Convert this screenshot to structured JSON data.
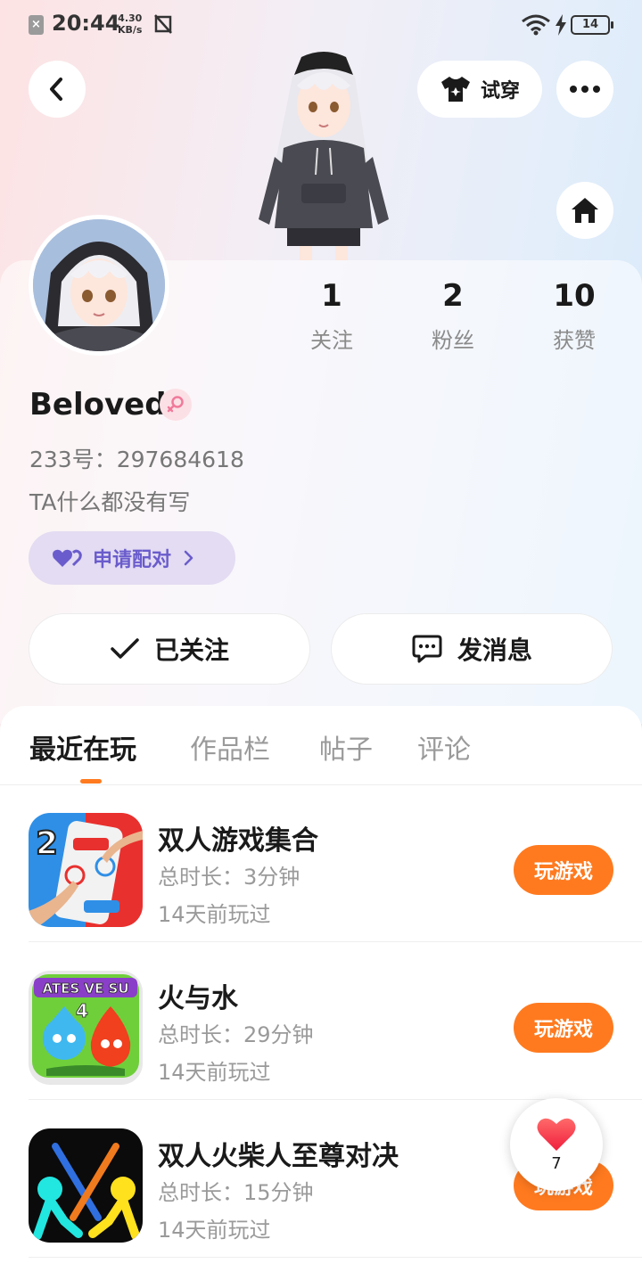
{
  "status_bar": {
    "time": "20:44",
    "speed_value": "4.30",
    "speed_unit": "KB/s",
    "battery": "14"
  },
  "header": {
    "try_on_label": "试穿"
  },
  "profile": {
    "stats": [
      {
        "value": "1",
        "label": "关注"
      },
      {
        "value": "2",
        "label": "粉丝"
      },
      {
        "value": "10",
        "label": "获赞"
      }
    ],
    "name": "Beloved",
    "uid": "233号：297684618",
    "bio": "TA什么都没有写",
    "pair_label": "申请配对",
    "follow_label": "已关注",
    "message_label": "发消息"
  },
  "tabs": [
    {
      "label": "最近在玩",
      "active": true
    },
    {
      "label": "作品栏",
      "active": false
    },
    {
      "label": "帖子",
      "active": false
    },
    {
      "label": "评论",
      "active": false
    }
  ],
  "games": [
    {
      "title": "双人游戏集合",
      "duration": "总时长：3分钟",
      "last_played": "14天前玩过",
      "button": "玩游戏"
    },
    {
      "title": "火与水",
      "duration": "总时长：29分钟",
      "last_played": "14天前玩过",
      "button": "玩游戏"
    },
    {
      "title": "双人火柴人至尊对决",
      "duration": "总时长：15分钟",
      "last_played": "14天前玩过",
      "button": "玩游戏"
    }
  ],
  "game_icon_text": {
    "g1_number": "2",
    "g2_banner": "ATES VE SU",
    "g2_number": "4"
  },
  "like_float": {
    "count": "7"
  },
  "colors": {
    "accent_orange": "#ff7a1f",
    "pair_purple": "#6a5ccc",
    "gender_pink": "#f07a9a"
  }
}
